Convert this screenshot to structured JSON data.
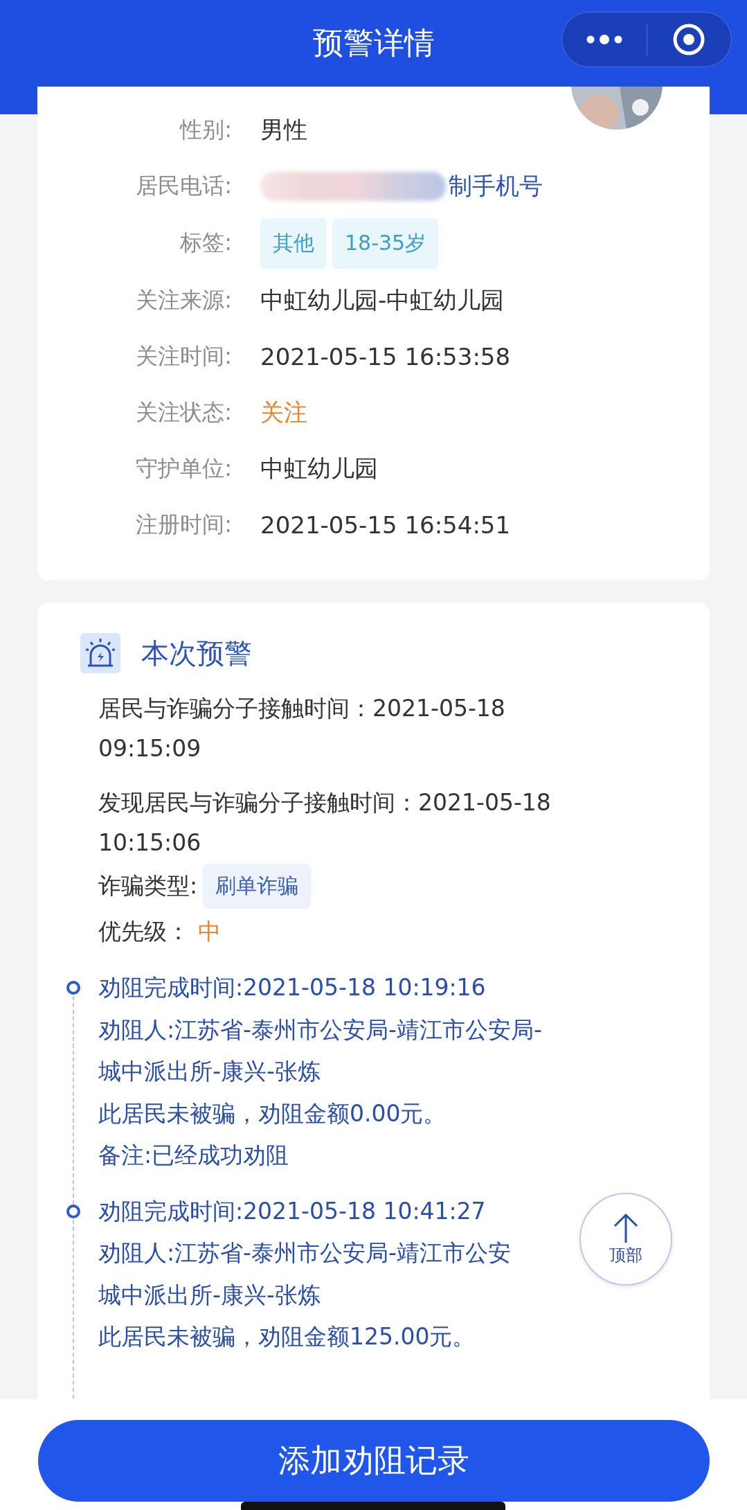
{
  "header": {
    "title": "预警详情"
  },
  "resident": {
    "fields": [
      {
        "kind": "text",
        "label": "性别:",
        "value": "男性"
      },
      {
        "kind": "redacted",
        "label": "居民电话:",
        "value": "制手机号"
      },
      {
        "kind": "tags",
        "label": "标签:",
        "tags": [
          "其他",
          "18-35岁"
        ]
      },
      {
        "kind": "text",
        "label": "关注来源:",
        "value": "中虹幼儿园-中虹幼儿园"
      },
      {
        "kind": "text",
        "label": "关注时间:",
        "value": "2021-05-15 16:53:58"
      },
      {
        "kind": "status",
        "label": "关注状态:",
        "value": "关注"
      },
      {
        "kind": "text",
        "label": "守护单位:",
        "value": "中虹幼儿园"
      },
      {
        "kind": "text",
        "label": "注册时间:",
        "value": "2021-05-15 16:54:51"
      }
    ]
  },
  "alert": {
    "title": "本次预警",
    "lines": [
      {
        "kind": "text",
        "text": "居民与诈骗分子接触时间：2021-05-18"
      },
      {
        "kind": "text",
        "text": "09:15:09"
      },
      {
        "kind": "text",
        "text": "发现居民与诈骗分子接触时间：2021-05-18"
      },
      {
        "kind": "text",
        "text": "10:15:06"
      },
      {
        "kind": "tag",
        "label": "诈骗类型:",
        "value": "刷单诈骗"
      },
      {
        "kind": "status",
        "label": "优先级：",
        "value": "中"
      }
    ],
    "records": [
      {
        "lines": [
          "劝阻完成时间:2021-05-18 10:19:16",
          "劝阻人:江苏省-泰州市公安局-靖江市公安局-",
          "城中派出所-康兴-张炼",
          "此居民未被骗，劝阻金额0.00元。",
          "备注:已经成功劝阻"
        ]
      },
      {
        "lines": [
          "劝阻完成时间:2021-05-18 10:41:27",
          "劝阻人:江苏省-泰州市公安局-靖江市公安",
          "城中派出所-康兴-张炼",
          "此居民未被骗，劝阻金额125.00元。"
        ]
      }
    ]
  },
  "back_to_top": {
    "label": "顶部"
  },
  "add_button": {
    "label": "添加劝阻记录"
  }
}
